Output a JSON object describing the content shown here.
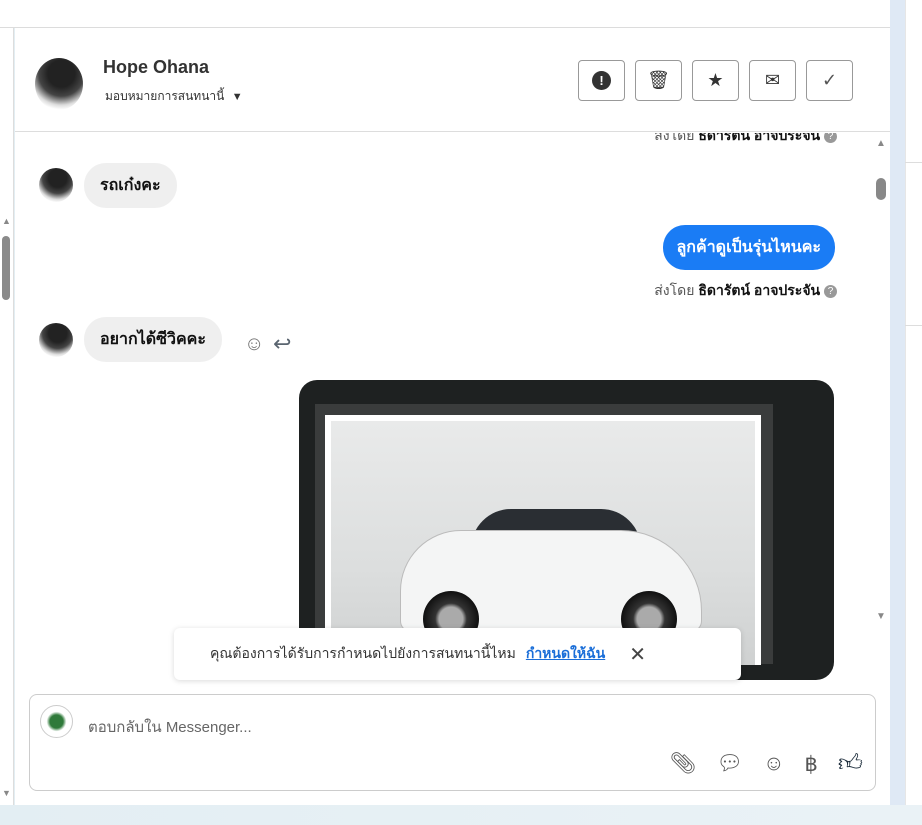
{
  "header": {
    "contact_name": "Hope Ohana",
    "assign_label": "มอบหมายการสนทนานี้",
    "actions": [
      {
        "icon": "alert-icon",
        "glyph": "❗"
      },
      {
        "icon": "trash-icon",
        "glyph": "🗑"
      },
      {
        "icon": "star-icon",
        "glyph": "★"
      },
      {
        "icon": "mail-icon",
        "glyph": "✉"
      },
      {
        "icon": "check-icon",
        "glyph": "✓"
      }
    ]
  },
  "messages": [
    {
      "type": "sent_by",
      "prefix": "ส่งโดย",
      "agent": "ธิดารัตน์ อาจประจัน"
    },
    {
      "type": "incoming",
      "text": "รถเก๋งคะ"
    },
    {
      "type": "outgoing",
      "text": "ลูกค้าดูเป็นรุ่นไหนคะ"
    },
    {
      "type": "sent_by",
      "prefix": "ส่งโดย",
      "agent": "ธิดารัตน์ อาจประจัน"
    },
    {
      "type": "incoming",
      "text": "อยากได้ซีวิคคะ"
    },
    {
      "type": "outgoing_image",
      "alt": "white Honda Civic"
    }
  ],
  "notice": {
    "text": "คุณต้องการได้รับการกำหนดไปยังการสนทนานี้ไหม",
    "link": "กำหนดให้ฉัน"
  },
  "composer": {
    "placeholder": "ตอบกลับใน Messenger...",
    "tools": [
      "attach-icon",
      "saved-reply-icon",
      "emoji-icon",
      "baht-icon",
      "thumbs-up-icon"
    ]
  },
  "colors": {
    "accent": "#1a7cf5",
    "link": "#1a6ed8"
  }
}
